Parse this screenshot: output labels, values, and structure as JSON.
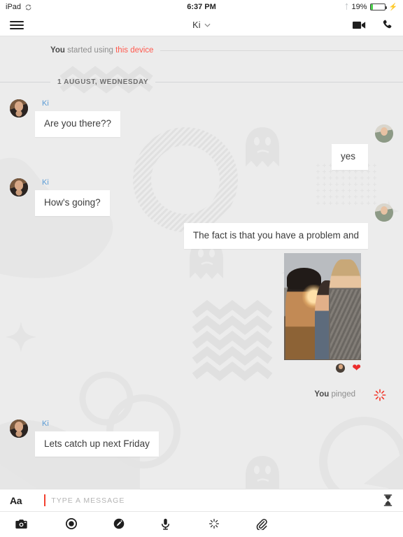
{
  "status_bar": {
    "device_label": "iPad",
    "device_icon": "rotation-lock-icon",
    "time": "6:37 PM",
    "bluetooth_icon": "bluetooth-icon",
    "battery_percent": "19%",
    "battery_level": 19,
    "charging": true,
    "battery_color": "#4cd24c"
  },
  "header": {
    "menu_icon": "hamburger-menu-icon",
    "title": "Ki",
    "chevron": "⌄",
    "video_call_icon": "video-camera-icon",
    "voice_call_icon": "phone-icon"
  },
  "system_messages": {
    "device_notice": {
      "bold": "You",
      "text": " started using ",
      "accent": "this device"
    },
    "date_divider": "1 AUGUST, WEDNESDAY"
  },
  "messages": [
    {
      "id": "m1",
      "side": "left",
      "sender": "Ki",
      "text": "Are you there??",
      "avatar": "dark"
    },
    {
      "id": "m2",
      "side": "right",
      "sender": "",
      "text": "yes",
      "avatar": "light"
    },
    {
      "id": "m3",
      "side": "left",
      "sender": "Ki",
      "text": "How's going?",
      "avatar": "dark"
    },
    {
      "id": "m4",
      "side": "right",
      "sender": "",
      "text": "The fact is that you have a problem and",
      "avatar": "light"
    },
    {
      "id": "m6",
      "side": "left",
      "sender": "Ki",
      "text": "Lets catch up next Friday",
      "avatar": "dark"
    }
  ],
  "photo_message": {
    "id": "m5",
    "alt": "three-friends-laughing-photo",
    "reaction_icon": "heart-icon",
    "reaction_color": "#ec2d2d",
    "reader_avatar": "mini-avatar"
  },
  "ping_message": {
    "bold": "You",
    "text": " pinged",
    "icon": "ping-burst-icon",
    "color": "#f23a2e"
  },
  "input_bar": {
    "format_label": "Aa",
    "placeholder": "TYPE A MESSAGE",
    "value": "",
    "caret_color": "#f2402f",
    "timer_icon": "hourglass-icon"
  },
  "toolbar": {
    "items": [
      {
        "name": "camera-icon",
        "label": "Camera"
      },
      {
        "name": "record-icon",
        "label": "Record"
      },
      {
        "name": "draw-icon",
        "label": "Draw"
      },
      {
        "name": "microphone-icon",
        "label": "Microphone"
      },
      {
        "name": "ping-icon",
        "label": "Ping"
      },
      {
        "name": "attachment-icon",
        "label": "Attach"
      }
    ]
  },
  "theme": {
    "chat_background": "#ececec",
    "bubble_background": "#ffffff",
    "sender_name_color": "#5b9bd5",
    "accent_red": "#ff5a4e"
  }
}
